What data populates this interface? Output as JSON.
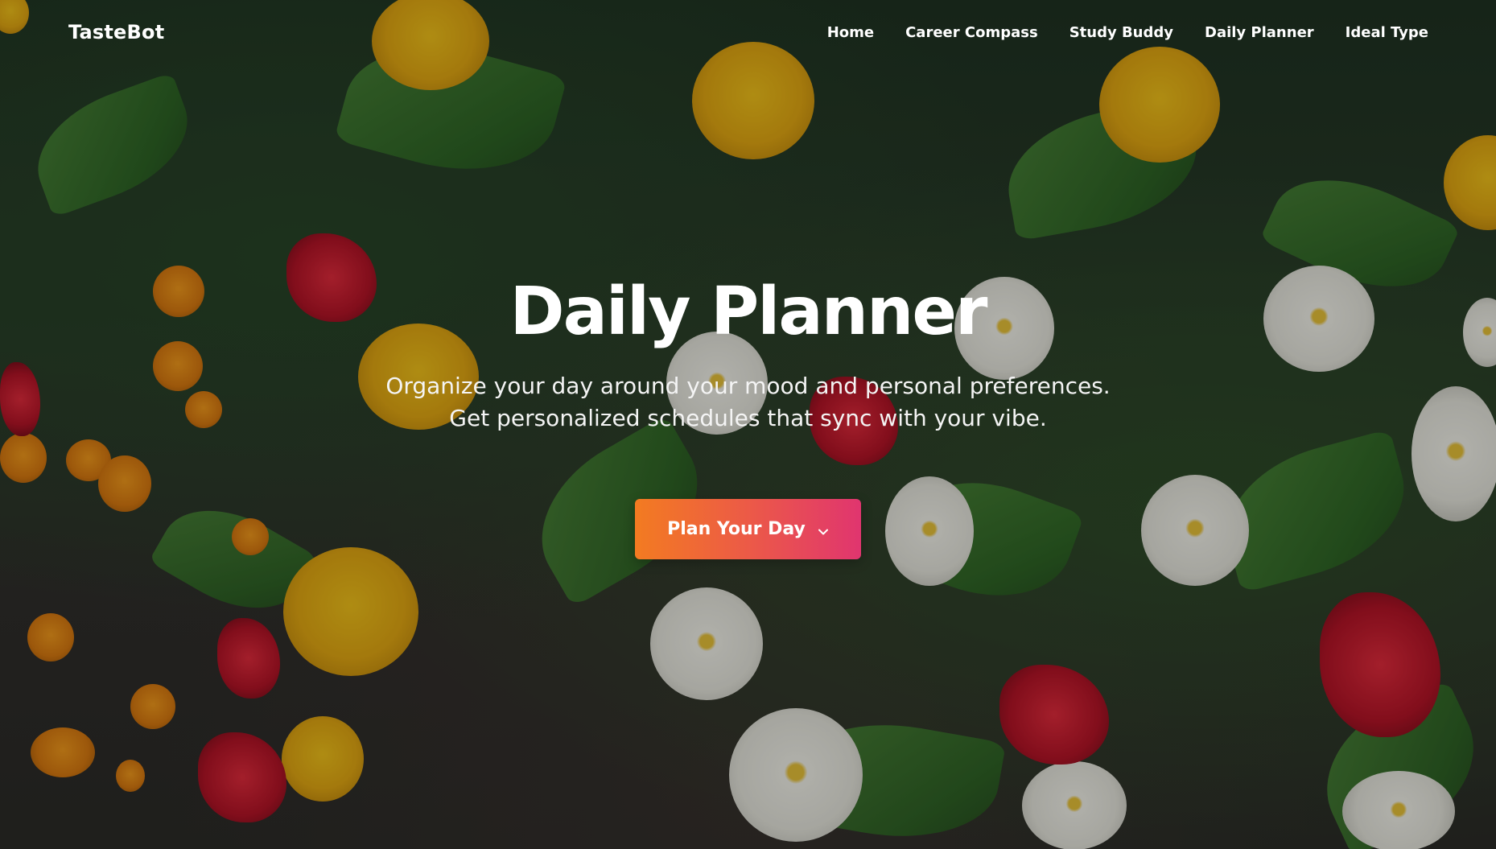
{
  "nav": {
    "brand": "TasteBot",
    "links": [
      {
        "label": "Home"
      },
      {
        "label": "Career Compass"
      },
      {
        "label": "Study Buddy"
      },
      {
        "label": "Daily Planner"
      },
      {
        "label": "Ideal Type"
      }
    ]
  },
  "hero": {
    "title": "Daily Planner",
    "subtitle": "Organize your day around your mood and personal preferences. Get personalized schedules that sync with your vibe.",
    "cta_label": "Plan Your Day",
    "cta_icon": "chevron-down-icon",
    "background": "garden-flowers-photo"
  },
  "colors": {
    "cta_gradient_start": "#f37b21",
    "cta_gradient_end": "#e0356f",
    "text": "#ffffff"
  }
}
